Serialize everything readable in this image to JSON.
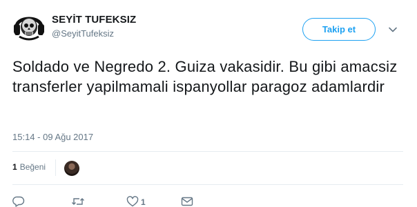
{
  "author": {
    "display_name": "SEYİT TUFEKSIZ",
    "screen_name": "@SeyitTufeksiz",
    "avatar_icon": "skull-headphones-avatar"
  },
  "follow_button": {
    "label": "Takip et"
  },
  "tweet": {
    "text": "Soldado ve Negredo 2. Guiza vakasidir. Bu gibi amacsiz transferler yapilmamali ispanyollar paragoz adamlardir",
    "timestamp": "15:14 - 09 Ağu 2017"
  },
  "stats": {
    "likes_count": "1",
    "likes_label": "Beğeni"
  },
  "actions": {
    "like_count": "1"
  },
  "colors": {
    "accent": "#1da1f2",
    "secondary_text": "#657786",
    "divider": "#e6ecf0"
  }
}
